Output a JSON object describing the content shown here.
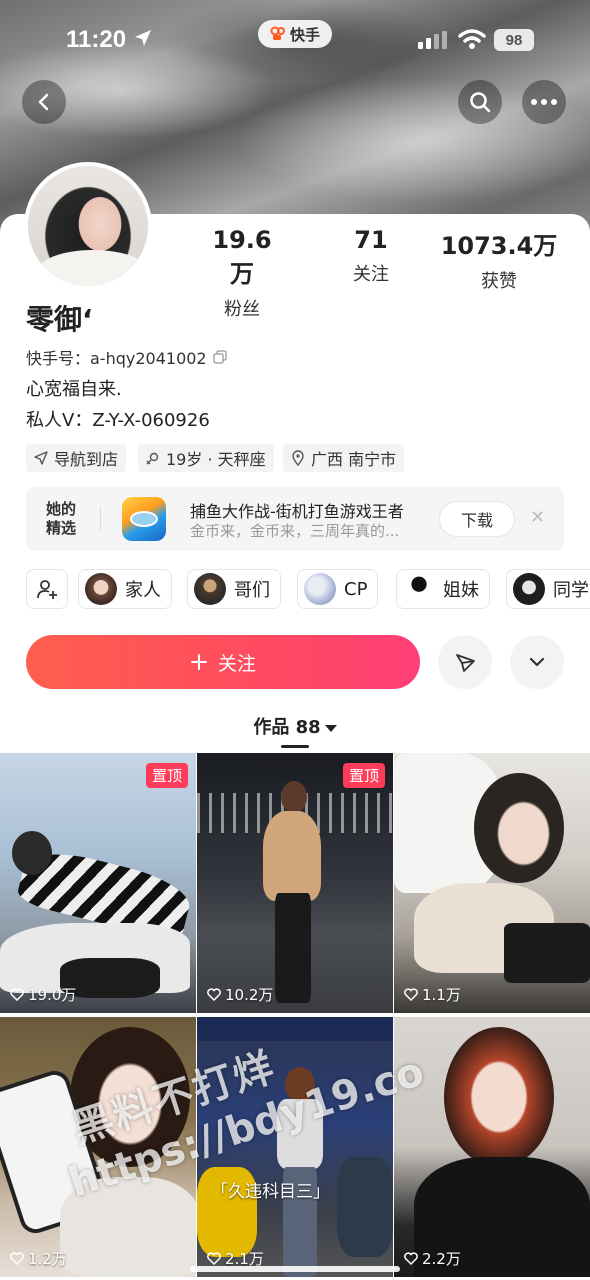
{
  "status_bar": {
    "time": "11:20",
    "app_name": "快手",
    "battery": "98"
  },
  "profile": {
    "stats": [
      {
        "value": "19.6万",
        "label": "粉丝"
      },
      {
        "value": "71",
        "label": "关注"
      },
      {
        "value": "1073.4万",
        "label": "获赞"
      }
    ],
    "name": "零御‘",
    "kuaishou_id": "快手号：a-hqy2041002",
    "bio_line1": "心宽福自来.",
    "bio_line2": "私人V：Z-Y-X-060926",
    "tags": [
      "导航到店",
      "19岁 · 天秤座",
      "广西 南宁市"
    ]
  },
  "featured": {
    "label": "她的精选",
    "game_title": "捕鱼大作战-街机打鱼游戏王者",
    "game_subtitle": "金币来，金币来，三周年真的...",
    "download_label": "下载"
  },
  "groups": [
    "家人",
    "哥们",
    "CP",
    "姐妹",
    "同学"
  ],
  "actions": {
    "follow_label": "关注"
  },
  "works": {
    "tab_label": "作品 88"
  },
  "videos": [
    {
      "likes": "19.0万",
      "pinned": "置顶"
    },
    {
      "likes": "10.2万",
      "pinned": "置顶"
    },
    {
      "likes": "1.1万",
      "pinned": ""
    },
    {
      "likes": "1.2万",
      "pinned": ""
    },
    {
      "likes": "2.1万",
      "pinned": ""
    },
    {
      "likes": "2.2万",
      "pinned": ""
    }
  ],
  "video_captions": {
    "v5": "「久违科目三」"
  },
  "watermark": {
    "line1": "黑料不打烊",
    "line2": "https://bdy19.co"
  },
  "colors": {
    "accent": "#ff4a60",
    "pin": "#ff3d5a"
  }
}
